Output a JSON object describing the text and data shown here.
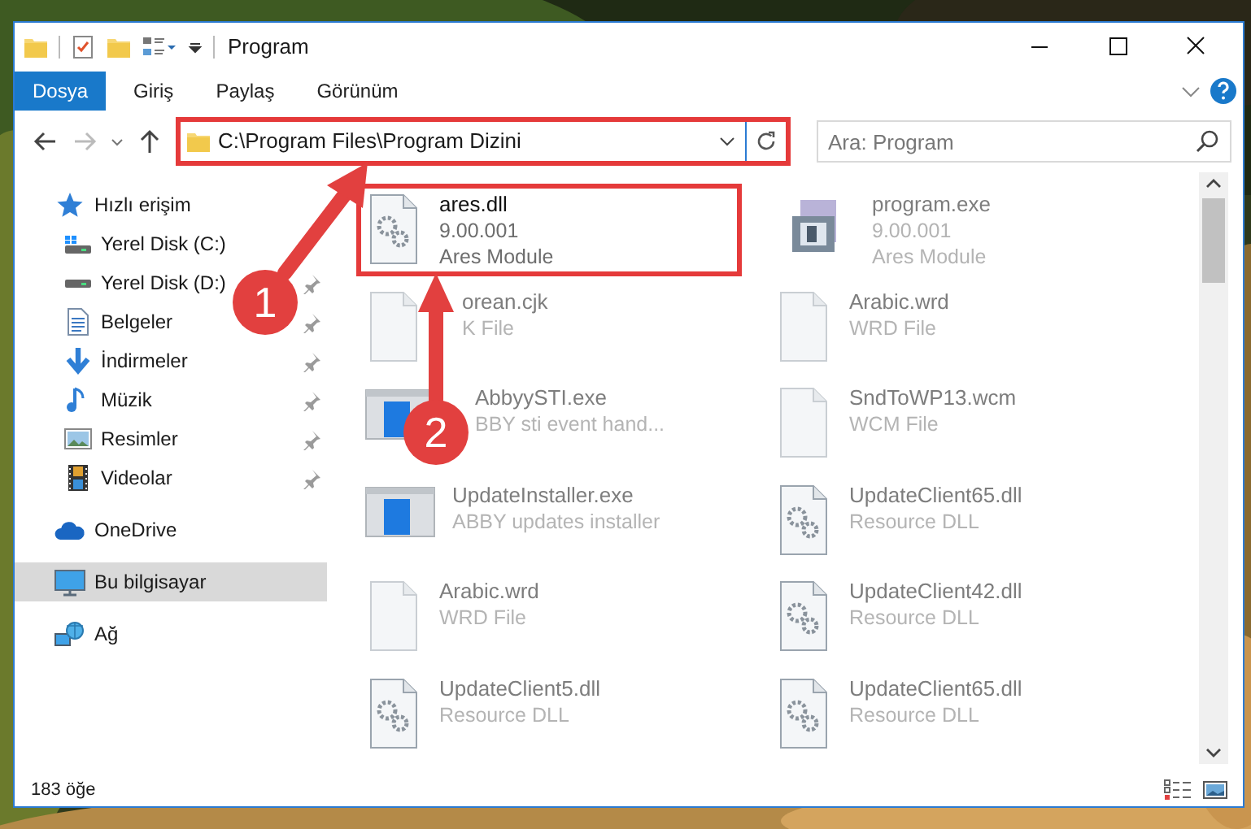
{
  "window": {
    "title": "Program"
  },
  "ribbon_tabs": [
    {
      "label": "Dosya",
      "kind": "file"
    },
    {
      "label": "Giriş",
      "kind": "tab"
    },
    {
      "label": "Paylaş",
      "kind": "tab"
    },
    {
      "label": "Görünüm",
      "kind": "tab"
    }
  ],
  "address_bar": {
    "path": "C:\\Program Files\\Program Dizini",
    "highlighted": true
  },
  "search": {
    "placeholder": "Ara: Program"
  },
  "navigation": [
    {
      "label": "Hızlı erişim",
      "selected": false,
      "children": [
        {
          "label": "Yerel Disk (C:)",
          "pinned": false,
          "selected": false
        },
        {
          "label": "Yerel Disk (D:)",
          "pinned": true,
          "selected": false
        },
        {
          "label": "Belgeler",
          "pinned": true,
          "selected": false
        },
        {
          "label": "İndirmeler",
          "pinned": true,
          "selected": false
        },
        {
          "label": "Müzik",
          "pinned": true,
          "selected": false
        },
        {
          "label": "Resimler",
          "pinned": true,
          "selected": false
        },
        {
          "label": "Videolar",
          "pinned": true,
          "selected": false
        }
      ]
    },
    {
      "label": "OneDrive",
      "selected": false
    },
    {
      "label": "Bu bilgisayar",
      "selected": true
    },
    {
      "label": "Ağ",
      "selected": false
    }
  ],
  "files": [
    {
      "name": "ares.dll",
      "lines": [
        "9.00.001",
        "Ares Module"
      ],
      "kind": "dll",
      "highlighted": true,
      "blurred": false,
      "partly_hidden": false
    },
    {
      "name": "program.exe",
      "lines": [
        "9.00.001",
        "Ares Module"
      ],
      "kind": "setup",
      "highlighted": false,
      "blurred": true,
      "partly_hidden": false
    },
    {
      "name": "orean.cjk",
      "lines": [
        "K File"
      ],
      "kind": "doc",
      "highlighted": false,
      "blurred": true,
      "partly_hidden": true
    },
    {
      "name": "Arabic.wrd",
      "lines": [
        "WRD File"
      ],
      "kind": "doc",
      "highlighted": false,
      "blurred": true,
      "partly_hidden": false
    },
    {
      "name": "AbbyySTI.exe",
      "lines": [
        "BBY sti event hand..."
      ],
      "kind": "app",
      "highlighted": false,
      "blurred": true,
      "partly_hidden": true
    },
    {
      "name": "SndToWP13.wcm",
      "lines": [
        "WCM File"
      ],
      "kind": "doc",
      "highlighted": false,
      "blurred": true,
      "partly_hidden": false
    },
    {
      "name": "UpdateInstaller.exe",
      "lines": [
        "ABBY updates installer"
      ],
      "kind": "app",
      "highlighted": false,
      "blurred": true,
      "partly_hidden": false
    },
    {
      "name": "UpdateClient65.dll",
      "lines": [
        "Resource DLL"
      ],
      "kind": "dll",
      "highlighted": false,
      "blurred": true,
      "partly_hidden": false
    },
    {
      "name": "Arabic.wrd",
      "lines": [
        "WRD File"
      ],
      "kind": "doc",
      "highlighted": false,
      "blurred": true,
      "partly_hidden": false
    },
    {
      "name": "UpdateClient42.dll",
      "lines": [
        "Resource DLL"
      ],
      "kind": "dll",
      "highlighted": false,
      "blurred": true,
      "partly_hidden": false
    },
    {
      "name": "UpdateClient5.dll",
      "lines": [
        "Resource DLL"
      ],
      "kind": "dll",
      "highlighted": false,
      "blurred": true,
      "partly_hidden": false
    },
    {
      "name": "UpdateClient65.dll",
      "lines": [
        "Resource DLL"
      ],
      "kind": "dll",
      "highlighted": false,
      "blurred": true,
      "partly_hidden": false
    }
  ],
  "annotations": [
    {
      "number": "1"
    },
    {
      "number": "2"
    }
  ],
  "status_bar": {
    "item_count": "183 öğe"
  }
}
